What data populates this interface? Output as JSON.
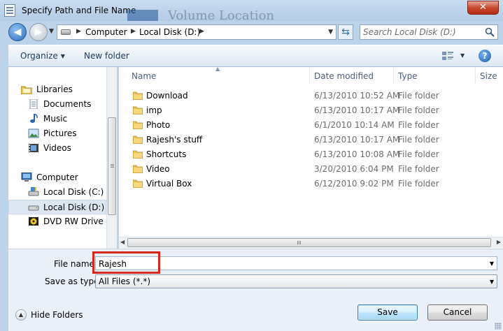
{
  "window": {
    "title": "Specify Path and File Name",
    "background_text": "Volume Location",
    "close_glyph": "✕"
  },
  "address_bar": {
    "crumbs": [
      "Computer",
      "Local Disk (D:)"
    ],
    "search_placeholder": "Search Local Disk (D:)"
  },
  "toolbar": {
    "organize": "Organize",
    "new_folder": "New folder",
    "help": "?"
  },
  "nav_pane": {
    "items": [
      {
        "label": "Libraries",
        "icon": "libraries-icon"
      },
      {
        "label": "Documents",
        "icon": "documents-icon"
      },
      {
        "label": "Music",
        "icon": "music-icon"
      },
      {
        "label": "Pictures",
        "icon": "pictures-icon"
      },
      {
        "label": "Videos",
        "icon": "videos-icon"
      },
      {
        "label": "Computer",
        "icon": "computer-icon"
      },
      {
        "label": "Local Disk (C:)",
        "icon": "drive-icon"
      },
      {
        "label": "Local Disk (D:)",
        "icon": "drive-icon",
        "selected": true
      },
      {
        "label": "DVD RW Drive (E:",
        "icon": "dvd-drive-icon"
      }
    ]
  },
  "file_list": {
    "columns": [
      "Name",
      "Date modified",
      "Type",
      "Size"
    ],
    "rows": [
      {
        "name": "Download",
        "date": "6/13/2010 10:52 AM",
        "type": "File folder"
      },
      {
        "name": "imp",
        "date": "6/13/2010 10:17 AM",
        "type": "File folder"
      },
      {
        "name": "Photo",
        "date": "6/1/2010 10:14 AM",
        "type": "File folder"
      },
      {
        "name": "Rajesh's stuff",
        "date": "6/13/2010 10:17 AM",
        "type": "File folder"
      },
      {
        "name": "Shortcuts",
        "date": "6/13/2010 10:08 AM",
        "type": "File folder"
      },
      {
        "name": "Video",
        "date": "3/20/2010 6:04 PM",
        "type": "File folder"
      },
      {
        "name": "Virtual Box",
        "date": "6/12/2010 9:02 PM",
        "type": "File folder"
      }
    ]
  },
  "form": {
    "file_name_label": "File name:",
    "file_name_value": "Rajesh",
    "save_type_label": "Save as type:",
    "save_type_value": "All Files (*.*)",
    "hide_folders": "Hide Folders",
    "save": "Save",
    "cancel": "Cancel"
  },
  "colors": {
    "highlight": "#d9261c",
    "chrome": "#bcd3ea"
  }
}
